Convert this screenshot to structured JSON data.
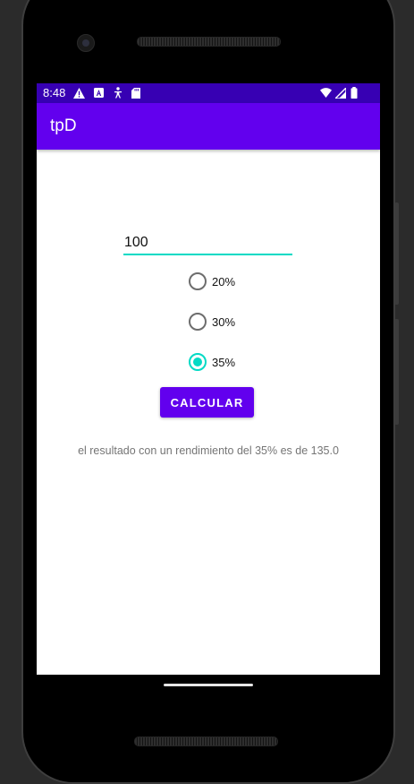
{
  "status_bar": {
    "time": "8:48",
    "left_icons": [
      "warning-icon",
      "a-badge-icon",
      "accessibility-icon",
      "sd-card-icon"
    ],
    "right_icons": [
      "wifi-icon",
      "cell-signal-icon",
      "battery-icon"
    ]
  },
  "app_bar": {
    "title": "tpD"
  },
  "form": {
    "amount_value": "100",
    "options": [
      {
        "label": "20%",
        "checked": false
      },
      {
        "label": "30%",
        "checked": false
      },
      {
        "label": "35%",
        "checked": true
      }
    ],
    "calculate_label": "CALCULAR",
    "result_text": "el resultado con un rendimiento del 35% es de 135.0"
  },
  "colors": {
    "status_bar": "#3700b3",
    "primary": "#6200ee",
    "accent": "#03dac5"
  }
}
